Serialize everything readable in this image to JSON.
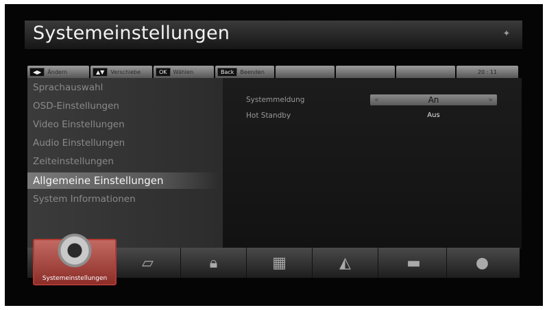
{
  "window": {
    "title": "Systemeinstellungen",
    "title_icon": "info-icon"
  },
  "hint_bar": [
    {
      "key": "◀▶",
      "label": "Ändern"
    },
    {
      "key": "▲▼",
      "label": "Verschiebe"
    },
    {
      "key": "OK",
      "label": "Wählen"
    },
    {
      "key": "Back",
      "label": "Beenden"
    }
  ],
  "clock": "20 : 11",
  "menu": {
    "items": [
      {
        "label": "Sprachauswahl"
      },
      {
        "label": "OSD-Einstellungen"
      },
      {
        "label": "Video Einstellungen"
      },
      {
        "label": "Audio Einstellungen"
      },
      {
        "label": "Zeiteinstellungen"
      },
      {
        "label": "Allgemeine Einstellungen"
      },
      {
        "label": "System Informationen"
      }
    ],
    "selected": "Allgemeine Einstellungen"
  },
  "settings": [
    {
      "label": "Systemmeldung",
      "value": "An",
      "selected": true
    },
    {
      "label": "Hot Standby",
      "value": "Aus",
      "selected": false
    }
  ],
  "dock": {
    "active_label": "Systemeinstellungen",
    "items": [
      {
        "icon": "gear-icon"
      },
      {
        "icon": "map-icon"
      },
      {
        "icon": "lock-icon"
      },
      {
        "icon": "puzzle-icon"
      },
      {
        "icon": "antenna-icon"
      },
      {
        "icon": "receiver-box-icon"
      },
      {
        "icon": "globe-icon"
      }
    ]
  },
  "colors": {
    "background": "#050505",
    "selected_row": "#7a7a7a",
    "active_dock": "#a8403a"
  }
}
